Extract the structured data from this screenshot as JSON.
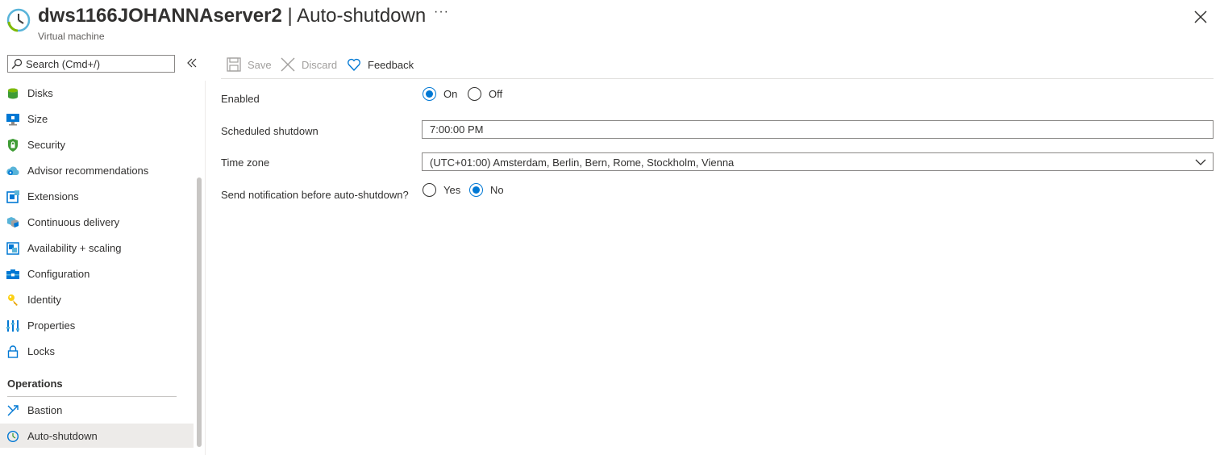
{
  "header": {
    "resource_name": "dws1166JOHANNAserver2",
    "separator": " | ",
    "blade_title": "Auto-shutdown",
    "subtitle": "Virtual machine",
    "more_label": "···"
  },
  "search": {
    "placeholder": "Search (Cmd+/)"
  },
  "sidebar": {
    "items": [
      {
        "label": "Disks",
        "icon": "disks-icon"
      },
      {
        "label": "Size",
        "icon": "size-icon"
      },
      {
        "label": "Security",
        "icon": "security-shield-icon"
      },
      {
        "label": "Advisor recommendations",
        "icon": "advisor-icon"
      },
      {
        "label": "Extensions",
        "icon": "extensions-icon"
      },
      {
        "label": "Continuous delivery",
        "icon": "continuous-delivery-icon"
      },
      {
        "label": "Availability + scaling",
        "icon": "availability-icon"
      },
      {
        "label": "Configuration",
        "icon": "configuration-icon"
      },
      {
        "label": "Identity",
        "icon": "identity-key-icon"
      },
      {
        "label": "Properties",
        "icon": "properties-icon"
      },
      {
        "label": "Locks",
        "icon": "lock-icon"
      }
    ],
    "section_operations": "Operations",
    "operations_items": [
      {
        "label": "Bastion",
        "icon": "bastion-icon"
      },
      {
        "label": "Auto-shutdown",
        "icon": "clock-icon",
        "active": true
      }
    ]
  },
  "toolbar": {
    "save_label": "Save",
    "discard_label": "Discard",
    "feedback_label": "Feedback"
  },
  "form": {
    "enabled_label": "Enabled",
    "enabled_on": "On",
    "enabled_off": "Off",
    "enabled_value": "On",
    "scheduled_label": "Scheduled shutdown",
    "scheduled_value": "7:00:00 PM",
    "timezone_label": "Time zone",
    "timezone_value": "(UTC+01:00) Amsterdam, Berlin, Bern, Rome, Stockholm, Vienna",
    "notify_label": "Send notification before auto-shutdown?",
    "notify_yes": "Yes",
    "notify_no": "No",
    "notify_value": "No"
  },
  "colors": {
    "accent": "#0078d4",
    "text": "#323130",
    "active_bg": "#edebe9",
    "disabled_text": "#a19f9d"
  }
}
